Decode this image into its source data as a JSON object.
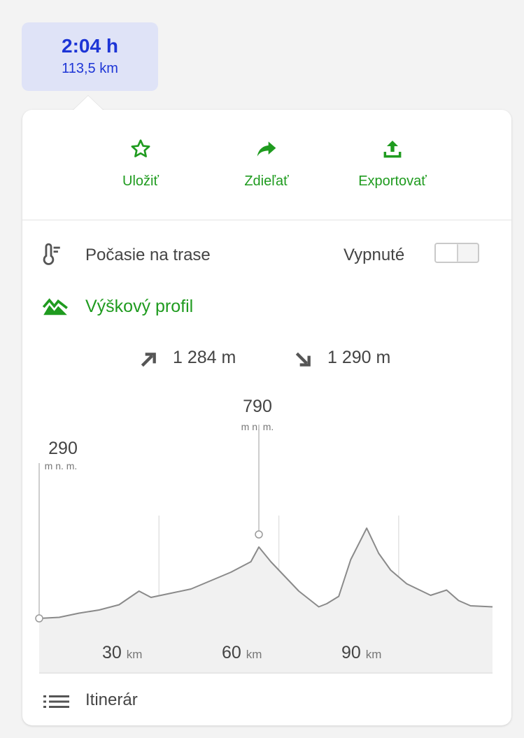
{
  "route": {
    "duration": "2:04 h",
    "distance": "113,5 km"
  },
  "actions": [
    {
      "label": "Uložiť",
      "icon": "star-outline-icon"
    },
    {
      "label": "Zdieľať",
      "icon": "share-arrow-icon"
    },
    {
      "label": "Exportovať",
      "icon": "export-upload-icon"
    }
  ],
  "weather": {
    "label": "Počasie na trase",
    "state": "Vypnuté",
    "enabled": false
  },
  "elevation": {
    "label": "Výškový profil",
    "ascent": "1 284 m",
    "descent": "1 290 m",
    "start_value": "290",
    "start_unit": "m n. m.",
    "peak_value": "790",
    "peak_unit": "m n. m.",
    "km_marks": [
      {
        "value": "30",
        "unit": "km"
      },
      {
        "value": "60",
        "unit": "km"
      },
      {
        "value": "90",
        "unit": "km"
      }
    ]
  },
  "itinerary": {
    "label": "Itinerár"
  },
  "colors": {
    "accent_green": "#1f9b1f",
    "route_blue": "#1d35d6",
    "badge_bg": "#dfe3f7"
  },
  "chart_data": {
    "type": "area",
    "x_unit": "km",
    "y_unit": "m n. m.",
    "x_ticks": [
      30,
      60,
      90
    ],
    "x": [
      0,
      5,
      10,
      15,
      20,
      25,
      28,
      33,
      38,
      43,
      48,
      53,
      55,
      58,
      61,
      65,
      70,
      72,
      75,
      78,
      82,
      85,
      88,
      92,
      98,
      102,
      105,
      108,
      113.5
    ],
    "y": [
      290,
      295,
      315,
      330,
      355,
      420,
      390,
      410,
      430,
      470,
      510,
      560,
      630,
      560,
      500,
      420,
      345,
      360,
      395,
      570,
      720,
      600,
      520,
      455,
      400,
      425,
      375,
      350,
      345
    ],
    "annotations": [
      {
        "x": 0,
        "y": 290,
        "label": "290"
      },
      {
        "x": 55,
        "y": 790,
        "label": "790"
      }
    ]
  }
}
